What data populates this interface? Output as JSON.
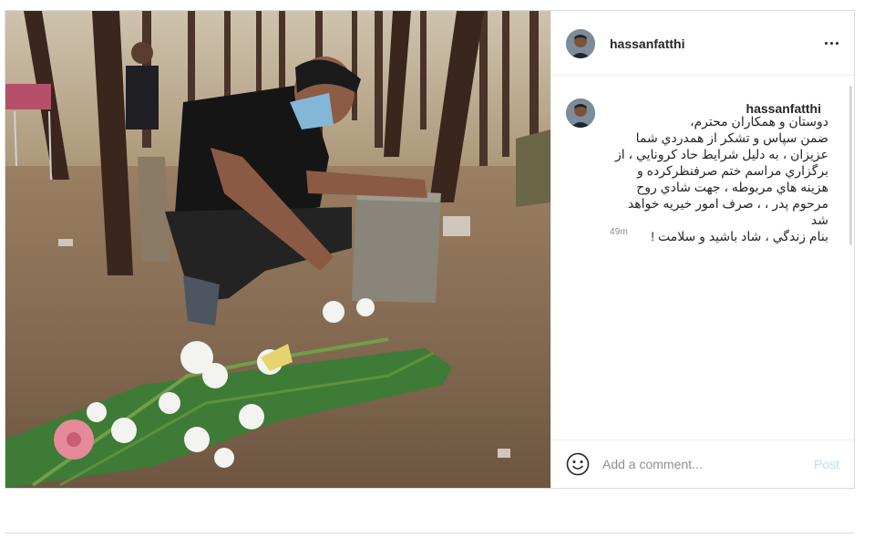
{
  "post": {
    "username": "hassanfatthi",
    "more_icon": "more-horizontal-icon",
    "caption": {
      "username": "hassanfatthi",
      "text": "دوستان و همکاران محترم،\nضمن سپاس و تشکر از همدردي شما عزيزان ، به دليل شرايط حاد کرونايي ، از برگزاري مراسم ختم صرفنظرکرده و هزينه هاي مربوطه ، جهت شادي روح مرحوم پدر ، ، صرف امور خيريه خواهد شد\nبنام زندگي ، شاد باشيد و سلامت !",
      "timestamp": "49m"
    },
    "comment_bar": {
      "emoji_icon": "smiley-icon",
      "placeholder": "Add a comment...",
      "post_label": "Post"
    }
  },
  "colors": {
    "border": "#dbdbdb",
    "text": "#262626",
    "muted": "#8e8e8e",
    "post_button_disabled": "#b2dffc"
  }
}
